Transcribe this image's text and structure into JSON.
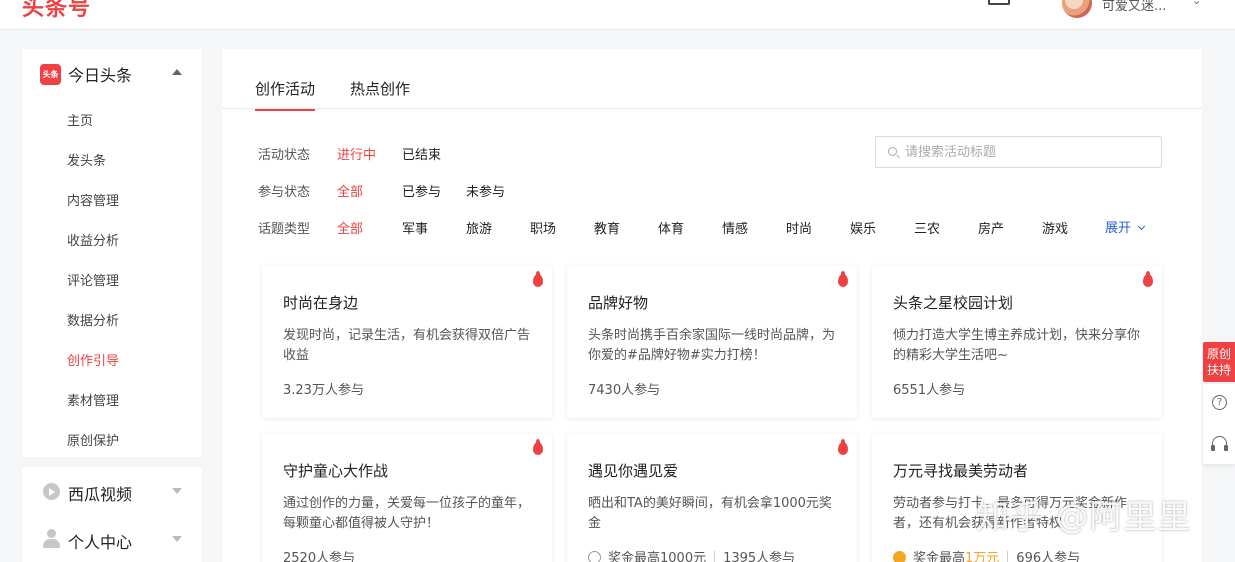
{
  "header": {
    "logo": "头条号",
    "username": "可爱又迷...",
    "caret": "⌄"
  },
  "sidebar": {
    "brand_badge": "头条",
    "title": "今日头条",
    "items": [
      {
        "label": "主页"
      },
      {
        "label": "发头条"
      },
      {
        "label": "内容管理"
      },
      {
        "label": "收益分析"
      },
      {
        "label": "评论管理"
      },
      {
        "label": "数据分析"
      },
      {
        "label": "创作引导",
        "active": true
      },
      {
        "label": "素材管理"
      },
      {
        "label": "原创保护"
      }
    ],
    "sections": [
      {
        "label": "西瓜视频",
        "icon": "video-icon"
      },
      {
        "label": "个人中心",
        "icon": "person-icon"
      }
    ]
  },
  "tabs": [
    {
      "label": "创作活动",
      "active": true
    },
    {
      "label": "热点创作"
    }
  ],
  "filters": {
    "status": {
      "label": "活动状态",
      "options": [
        "进行中",
        "已结束"
      ],
      "active": 0
    },
    "participation": {
      "label": "参与状态",
      "options": [
        "全部",
        "已参与",
        "未参与"
      ],
      "active": 0
    },
    "topic": {
      "label": "话题类型",
      "options": [
        "全部",
        "军事",
        "旅游",
        "职场",
        "教育",
        "体育",
        "情感",
        "时尚",
        "娱乐",
        "三农",
        "房产",
        "游戏"
      ],
      "active": 0
    },
    "expand_label": "展开"
  },
  "search": {
    "placeholder": "请搜索活动标题"
  },
  "cards": [
    {
      "title": "时尚在身边",
      "desc": "发现时尚，记录生活，有机会获得双倍广告收益",
      "count": "3.23万人参与"
    },
    {
      "title": "品牌好物",
      "desc": "头条时尚携手百余家国际一线时尚品牌，为你爱的#品牌好物#实力打榜！",
      "count": "7430人参与"
    },
    {
      "title": "头条之星校园计划",
      "desc": "倾力打造大学生博主养成计划，快来分享你的精彩大学生活吧~",
      "count": "6551人参与"
    },
    {
      "title": "守护童心大作战",
      "desc": "通过创作的力量，关爱每一位孩子的童年，每颗童心都值得被人守护！",
      "count": "2520人参与"
    },
    {
      "title": "遇见你遇见爱",
      "desc": "晒出和TA的美好瞬间，有机会拿1000元奖金",
      "prize": "奖金最高1000元",
      "count": "1395人参与"
    },
    {
      "title": "万元寻找最美劳动者",
      "desc": "劳动者参与打卡，最多可得万元奖金新作者，还有机会获得新作者特权",
      "prize_prefix": "奖金最高",
      "prize_highlight": "1万元",
      "count": "696人参与"
    }
  ],
  "float": {
    "original_label_1": "原创",
    "original_label_2": "扶持",
    "help": "?"
  },
  "watermark": "知乎 @阿里里",
  "colors": {
    "accent": "#f04142",
    "link": "#2a59d6",
    "prize": "#f5a623"
  }
}
